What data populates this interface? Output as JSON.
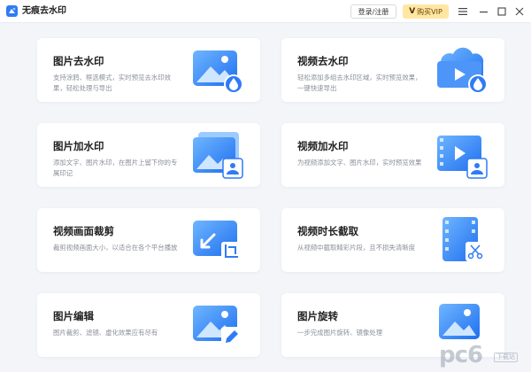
{
  "titlebar": {
    "title": "无痕去水印",
    "login_label": "登录/注册",
    "vip_label": "购买VIP",
    "vip_icon": "V"
  },
  "cards": [
    {
      "title": "图片去水印",
      "desc": "支持涂鸦、框选模式，实时预览去水印效果，轻松处理与导出",
      "icon": "image-remove-watermark-icon"
    },
    {
      "title": "视频去水印",
      "desc": "轻松添加多组去水印区域，实时预览效果，一键快速导出",
      "icon": "video-remove-watermark-icon"
    },
    {
      "title": "图片加水印",
      "desc": "添加文字、图片水印，在图片上留下你的专属印记",
      "icon": "image-add-watermark-icon"
    },
    {
      "title": "视频加水印",
      "desc": "为视频添加文字、图片水印，实时预览效果",
      "icon": "video-add-watermark-icon"
    },
    {
      "title": "视频画面裁剪",
      "desc": "裁剪视频画面大小，以适合在各个平台播放",
      "icon": "video-crop-icon"
    },
    {
      "title": "视频时长截取",
      "desc": "从视频中截取精彩片段，且不损失清晰度",
      "icon": "video-trim-icon"
    },
    {
      "title": "图片编辑",
      "desc": "图片裁剪、滤镜、虚化效果应有尽有",
      "icon": "image-edit-icon"
    },
    {
      "title": "图片旋转",
      "desc": "一步完成图片旋转、镜像处理",
      "icon": "image-rotate-icon"
    }
  ],
  "watermark": {
    "text": "pc6",
    "sub": "下载站"
  },
  "colors": {
    "accent": "#2f7bf5",
    "vip_bg": "#ffe7a3",
    "background": "#f3f5f9"
  }
}
